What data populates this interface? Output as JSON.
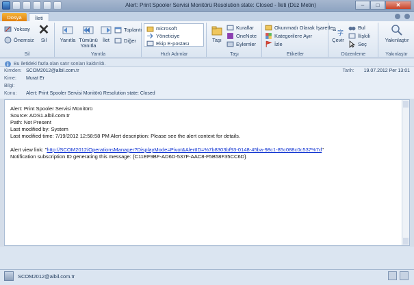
{
  "window": {
    "title": "Alert: Print Spooler Servisi Monitörü Resolution state: Closed - İleti (Düz Metin)",
    "minimize": "–",
    "maximize": "□",
    "close": "✕"
  },
  "tabs": {
    "file": "Dosya",
    "message": "İleti"
  },
  "ribbon": {
    "groups": {
      "delete": {
        "name": "Sil",
        "ignore": "Yoksay",
        "junk": "Önemsiz",
        "delete_btn": "Sil"
      },
      "respond": {
        "name": "Yanıtla",
        "reply": "Yanıtla",
        "reply_all": "Tümünü Yanıtla",
        "forward": "İlet",
        "meeting": "Toplantı",
        "more": "Diğer"
      },
      "quicksteps": {
        "name": "Hızlı Adımlar",
        "item1": "microsoft",
        "item2": "Yöneticiye",
        "item3": "Ekip E-postası"
      },
      "move": {
        "name": "Taşı",
        "move_btn": "Taşı",
        "rules": "Kurallar",
        "onenote": "OneNote",
        "actions": "Eylemler"
      },
      "tags": {
        "name": "Etiketler",
        "mark_read": "Okunmadı Olarak İşaretle",
        "categorize": "Kategorilere Ayır",
        "follow_up": "İzle"
      },
      "editing": {
        "name": "Düzenleme",
        "translate": "Çevir",
        "find": "Bul",
        "related": "İlişkili",
        "select": "Seç"
      },
      "zoom": {
        "name": "Yakınlaştır",
        "zoom_btn": "Yakınlaştır"
      }
    }
  },
  "infobar": {
    "text": "Bu iletideki fazla olan satır sonları kaldırıldı."
  },
  "headers": {
    "from_label": "Kimden:",
    "from_value": "SCOM2012@albil.com.tr",
    "to_label": "Kime:",
    "to_value": "Murat Er",
    "cc_label": "Bilgi:",
    "cc_value": "",
    "subject_label": "Konu:",
    "subject_value": "Alert: Print Spooler Servisi Monitörü Resolution state: Closed",
    "date_label": "Tarih:",
    "date_value": "19.07.2012 Per 13:01"
  },
  "message": {
    "lines": [
      "Alert: Print Spooler Servisi Monitörü",
      "Source: AOS1.albil.com.tr",
      "Path: Not Present",
      "Last modified by: System",
      "Last modified time: 7/19/2012 12:58:58 PM Alert description: Please see the alert context for details."
    ],
    "link_prefix": "Alert view link: \"",
    "link_url": "http://SCOM2012/OperationsManager?DisplayMode=Pivot&AlertID=%7b8303bf93-0148-45ba-98c1-85c088c0c537%7d",
    "link_suffix": "\"",
    "subscription_line": "Notification subscription ID generating this message: {C11EF9BF-AD6D-537F-AAC8-F5B58F35CC6D}"
  },
  "footer": {
    "sender": "SCOM2012@albil.com.tr"
  },
  "colors": {
    "accent": "#1e395b",
    "file_tab": "#e07b0a",
    "link": "#0b2fd0"
  }
}
